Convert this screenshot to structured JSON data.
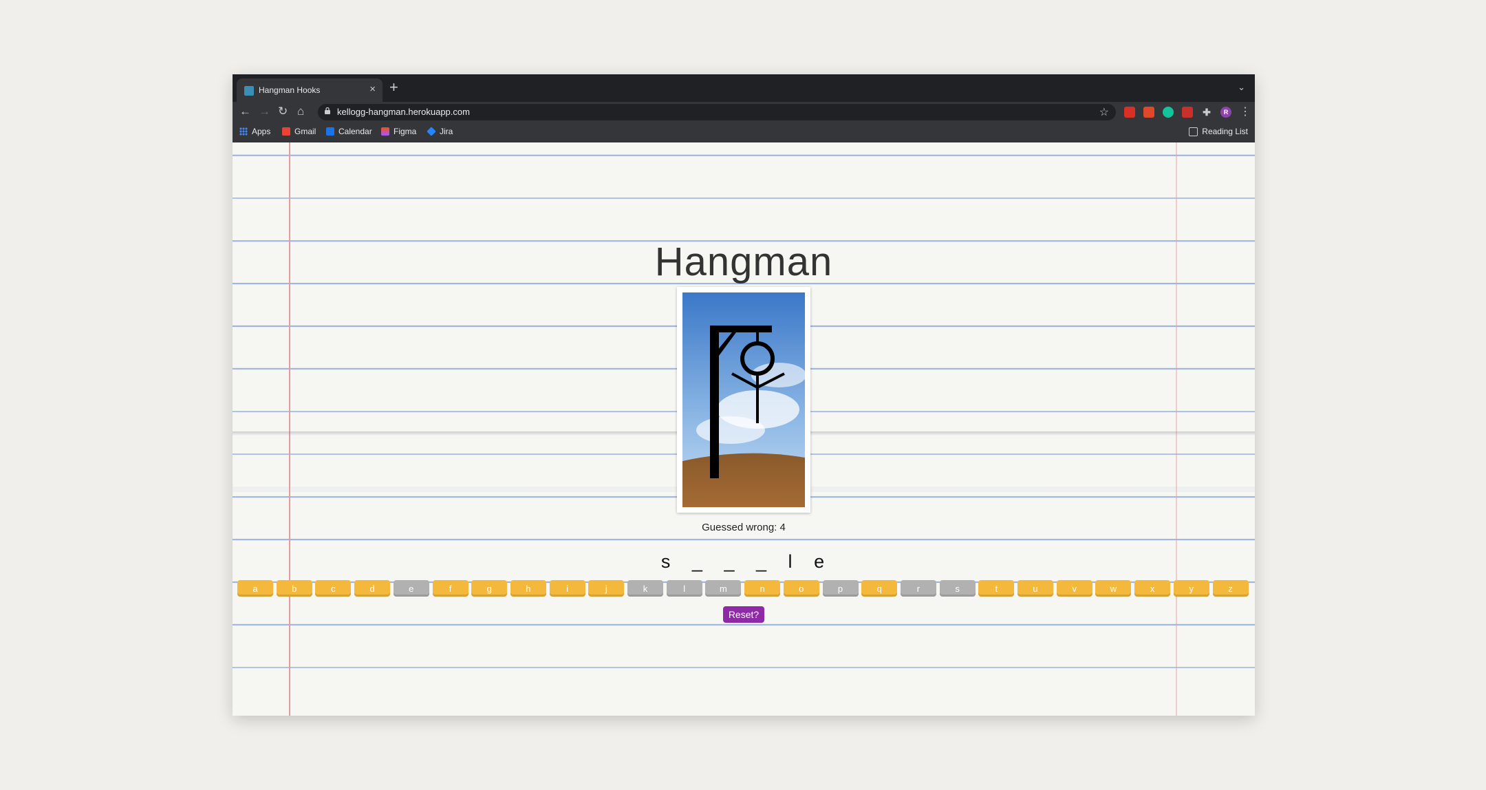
{
  "browser": {
    "tab_title": "Hangman Hooks",
    "tab_close": "×",
    "new_tab": "+",
    "tab_menu": "⌄",
    "url": "kellogg-hangman.herokuapp.com",
    "back": "←",
    "forward": "→",
    "reload": "↻",
    "home": "⌂",
    "star": "☆",
    "menu": "⋮",
    "profile_initial": "R"
  },
  "bookmarks": [
    {
      "label": "Apps",
      "color": "#4285f4"
    },
    {
      "label": "Gmail",
      "color": "#ea4335"
    },
    {
      "label": "Calendar",
      "color": "#1a73e8"
    },
    {
      "label": "Figma",
      "color": "#f24e1e"
    },
    {
      "label": "Jira",
      "color": "#2684ff"
    }
  ],
  "reading_list": "Reading List",
  "game": {
    "title": "Hangman",
    "wrong_label": "Guessed wrong: 4",
    "word": [
      "s",
      "_",
      "_",
      "_",
      "l",
      "e"
    ],
    "reset_label": "Reset?",
    "keys": [
      {
        "letter": "a",
        "used": false
      },
      {
        "letter": "b",
        "used": false
      },
      {
        "letter": "c",
        "used": false
      },
      {
        "letter": "d",
        "used": false
      },
      {
        "letter": "e",
        "used": true
      },
      {
        "letter": "f",
        "used": false
      },
      {
        "letter": "g",
        "used": false
      },
      {
        "letter": "h",
        "used": false
      },
      {
        "letter": "i",
        "used": false
      },
      {
        "letter": "j",
        "used": false
      },
      {
        "letter": "k",
        "used": true
      },
      {
        "letter": "l",
        "used": true
      },
      {
        "letter": "m",
        "used": true
      },
      {
        "letter": "n",
        "used": false
      },
      {
        "letter": "o",
        "used": false
      },
      {
        "letter": "p",
        "used": true
      },
      {
        "letter": "q",
        "used": false
      },
      {
        "letter": "r",
        "used": true
      },
      {
        "letter": "s",
        "used": true
      },
      {
        "letter": "t",
        "used": false
      },
      {
        "letter": "u",
        "used": false
      },
      {
        "letter": "v",
        "used": false
      },
      {
        "letter": "w",
        "used": false
      },
      {
        "letter": "x",
        "used": false
      },
      {
        "letter": "y",
        "used": false
      },
      {
        "letter": "z",
        "used": false
      }
    ]
  },
  "colors": {
    "key_available": "#f4b93c",
    "key_used": "#b1b1b1",
    "reset": "#8e2aa6"
  }
}
